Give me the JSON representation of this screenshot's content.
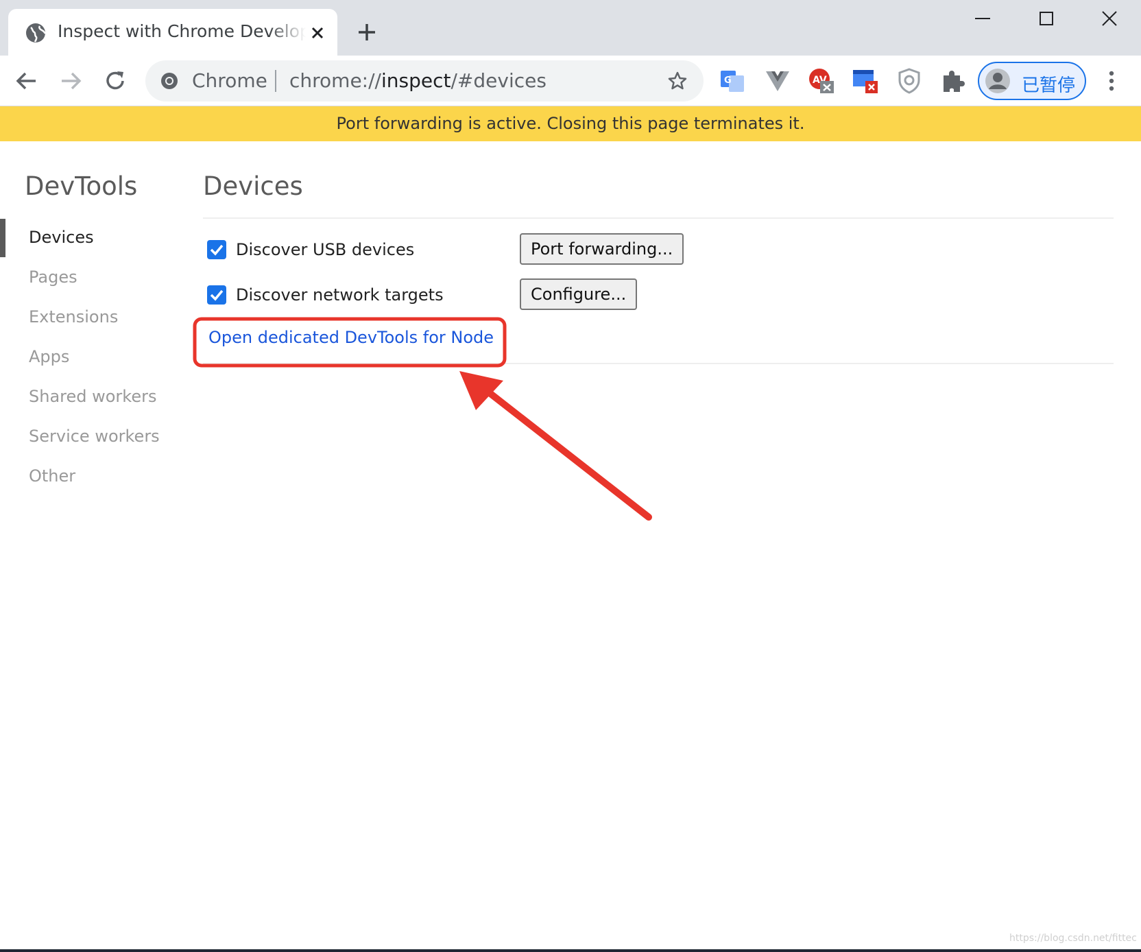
{
  "window": {
    "tab_title": "Inspect with Chrome Developer Tools",
    "controls": [
      "minimize",
      "maximize",
      "close"
    ]
  },
  "toolbar": {
    "chip_label": "Chrome",
    "url_scheme": "chrome://",
    "url_host": "inspect",
    "url_path": "/#devices",
    "profile_label": "已暂停",
    "extensions": [
      "google-translate-icon",
      "vue-devtools-icon",
      "adblock-icon",
      "tab-manager-icon",
      "shield-extension-icon",
      "extensions-puzzle-icon"
    ]
  },
  "infobar": {
    "message": "Port forwarding is active. Closing this page terminates it."
  },
  "sidebar": {
    "title": "DevTools",
    "items": [
      {
        "label": "Devices",
        "active": true
      },
      {
        "label": "Pages",
        "active": false
      },
      {
        "label": "Extensions",
        "active": false
      },
      {
        "label": "Apps",
        "active": false
      },
      {
        "label": "Shared workers",
        "active": false
      },
      {
        "label": "Service workers",
        "active": false
      },
      {
        "label": "Other",
        "active": false
      }
    ]
  },
  "main": {
    "title": "Devices",
    "discover_usb_label": "Discover USB devices",
    "discover_usb_checked": true,
    "port_forwarding_button": "Port forwarding...",
    "discover_network_label": "Discover network targets",
    "discover_network_checked": true,
    "configure_button": "Configure...",
    "node_link": "Open dedicated DevTools for Node"
  },
  "annotation": {
    "color": "#e8352b"
  },
  "watermark": "https://blog.csdn.net/fittec"
}
